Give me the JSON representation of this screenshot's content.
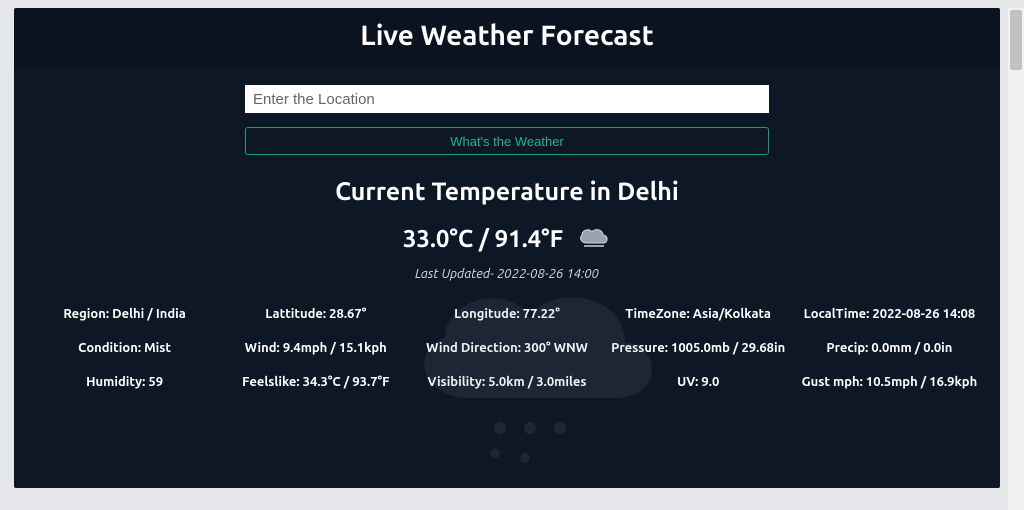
{
  "header": {
    "title": "Live Weather Forecast"
  },
  "search": {
    "placeholder": "Enter the Location",
    "button_label": "What's the Weather"
  },
  "main": {
    "current_title": "Current Temperature in Delhi",
    "temperature": "33.0°C / 91.4°F",
    "last_updated": "Last Updated- 2022-08-26 14:00"
  },
  "details": [
    "Region: Delhi / India",
    "Lattitude: 28.67°",
    "Longitude: 77.22°",
    "TimeZone: Asia/Kolkata",
    "LocalTime: 2022-08-26 14:08",
    "Condition: Mist",
    "Wind: 9.4mph / 15.1kph",
    "Wind Direction: 300° WNW",
    "Pressure: 1005.0mb / 29.68in",
    "Precip: 0.0mm / 0.0in",
    "Humidity: 59",
    "Feelslike: 34.3°C / 93.7°F",
    "Visibility: 5.0km / 3.0miles",
    "UV: 9.0",
    "Gust mph: 10.5mph / 16.9kph"
  ]
}
